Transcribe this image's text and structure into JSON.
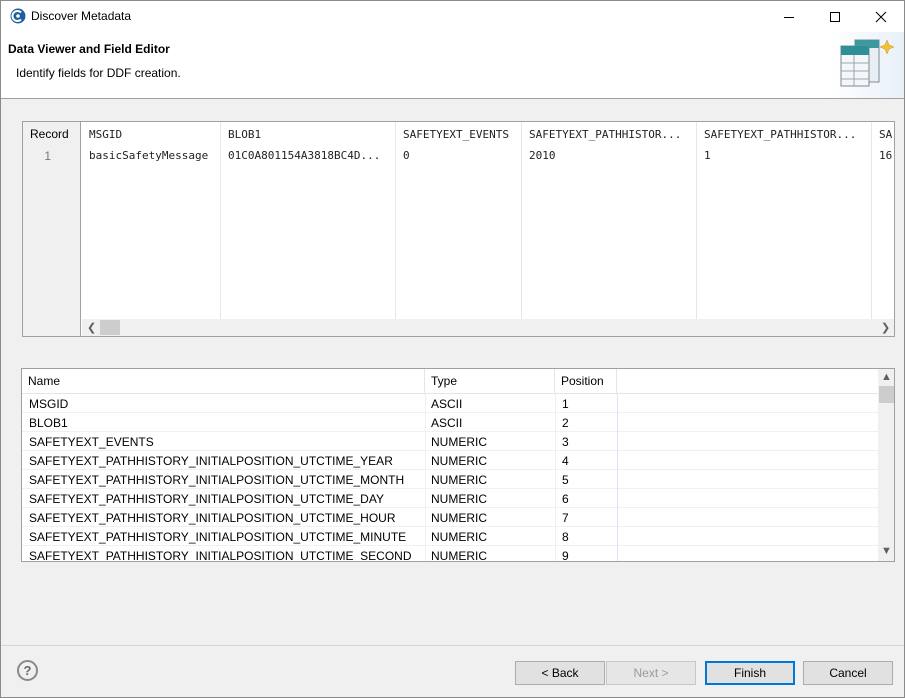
{
  "window": {
    "title": "Discover Metadata"
  },
  "header": {
    "title": "Data Viewer and Field Editor",
    "description": "Identify fields for DDF creation."
  },
  "record_table": {
    "record_header": "Record",
    "record_number": "1",
    "columns": [
      {
        "header": "MSGID",
        "value": "basicSafetyMessage"
      },
      {
        "header": "BLOB1",
        "value": "01C0A801154A3818BC4D..."
      },
      {
        "header": "SAFETYEXT_EVENTS",
        "value": "0"
      },
      {
        "header": "SAFETYEXT_PATHHISTOR...",
        "value": "2010"
      },
      {
        "header": "SAFETYEXT_PATHHISTOR...",
        "value": "1"
      },
      {
        "header": "SA",
        "value": "16"
      }
    ]
  },
  "fields_table": {
    "headers": {
      "name": "Name",
      "type": "Type",
      "position": "Position"
    },
    "rows": [
      {
        "name": "MSGID",
        "type": "ASCII",
        "position": "1"
      },
      {
        "name": "BLOB1",
        "type": "ASCII",
        "position": "2"
      },
      {
        "name": "SAFETYEXT_EVENTS",
        "type": "NUMERIC",
        "position": "3"
      },
      {
        "name": "SAFETYEXT_PATHHISTORY_INITIALPOSITION_UTCTIME_YEAR",
        "type": "NUMERIC",
        "position": "4"
      },
      {
        "name": "SAFETYEXT_PATHHISTORY_INITIALPOSITION_UTCTIME_MONTH",
        "type": "NUMERIC",
        "position": "5"
      },
      {
        "name": "SAFETYEXT_PATHHISTORY_INITIALPOSITION_UTCTIME_DAY",
        "type": "NUMERIC",
        "position": "6"
      },
      {
        "name": "SAFETYEXT_PATHHISTORY_INITIALPOSITION_UTCTIME_HOUR",
        "type": "NUMERIC",
        "position": "7"
      },
      {
        "name": "SAFETYEXT_PATHHISTORY_INITIALPOSITION_UTCTIME_MINUTE",
        "type": "NUMERIC",
        "position": "8"
      },
      {
        "name": "SAFETYEXT_PATHHISTORY_INITIALPOSITION_UTCTIME_SECOND",
        "type": "NUMERIC",
        "position": "9"
      }
    ]
  },
  "buttons": {
    "help": "?",
    "back": "< Back",
    "next": "Next >",
    "finish": "Finish",
    "cancel": "Cancel"
  },
  "icons": {
    "app": "app-logo-icon",
    "banner": "table-wizard-icon",
    "minimize": "minimize-icon",
    "maximize": "maximize-icon",
    "close": "close-icon"
  },
  "colors": {
    "accent": "#0078d7",
    "app_icon": "#1f5f9e"
  }
}
